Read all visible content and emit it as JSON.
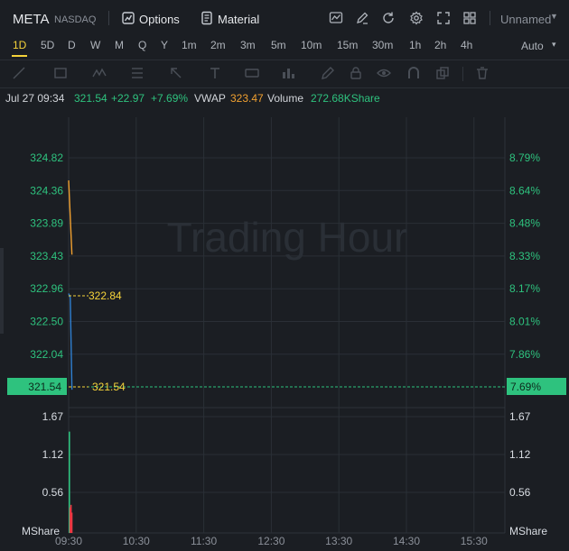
{
  "header": {
    "symbol": "META",
    "exchange": "NASDAQ",
    "options_label": "Options",
    "material_label": "Material",
    "layout_name": "Unnamed"
  },
  "timeframes": [
    "1D",
    "5D",
    "D",
    "W",
    "M",
    "Q",
    "Y",
    "1m",
    "2m",
    "3m",
    "5m",
    "10m",
    "15m",
    "30m",
    "1h",
    "2h",
    "4h"
  ],
  "active_timeframe": "1D",
  "scale_mode": "Auto",
  "info": {
    "datetime": "Jul 27 09:34",
    "price": "321.54",
    "change": "+22.97",
    "change_pct": "+7.69%",
    "vwap_label": "VWAP",
    "vwap_value": "323.47",
    "volume_label": "Volume",
    "volume_value": "272.68KShare"
  },
  "watermark": "Trading Hour",
  "colors": {
    "up": "#2ec27e",
    "vwap": "#f0a030",
    "price_line": "#2f7fd0",
    "yellow": "#f5d33a"
  },
  "chart_data": {
    "type": "line",
    "price_axis": {
      "ticks": [
        "324.82",
        "324.36",
        "323.89",
        "323.43",
        "322.96",
        "322.50",
        "322.04"
      ],
      "ylim": [
        321.58,
        324.82
      ]
    },
    "percent_axis": {
      "ticks": [
        "8.79%",
        "8.64%",
        "8.48%",
        "8.33%",
        "8.17%",
        "8.01%",
        "7.86%"
      ]
    },
    "current": {
      "price": "321.54",
      "pct": "7.69%"
    },
    "markers": [
      {
        "label": "322.84",
        "value": 322.84
      },
      {
        "label": "321.54",
        "value": 321.54
      }
    ],
    "x_ticks": [
      "09:30",
      "10:30",
      "11:30",
      "12:30",
      "13:30",
      "14:30",
      "15:30"
    ],
    "series": [
      {
        "color": "#f0a030",
        "points": [
          [
            0,
            324.5
          ],
          [
            4,
            323.45
          ]
        ]
      },
      {
        "color": "#2f7fd0",
        "points": [
          [
            0,
            322.9
          ],
          [
            2,
            322.84
          ],
          [
            4,
            321.54
          ]
        ]
      }
    ],
    "volume_axis": {
      "ticks": [
        "1.67",
        "1.12",
        "0.56"
      ],
      "unit": "MShare",
      "ylim": [
        0,
        1.8
      ]
    },
    "volume": [
      {
        "minute": 0,
        "value": 1.55,
        "color": "#2ec27e"
      },
      {
        "minute": 1,
        "value": 0.38,
        "color": "#ea3943"
      },
      {
        "minute": 2,
        "value": 0.42,
        "color": "#ea3943"
      },
      {
        "minute": 3,
        "value": 0.3,
        "color": "#ea3943"
      }
    ]
  }
}
